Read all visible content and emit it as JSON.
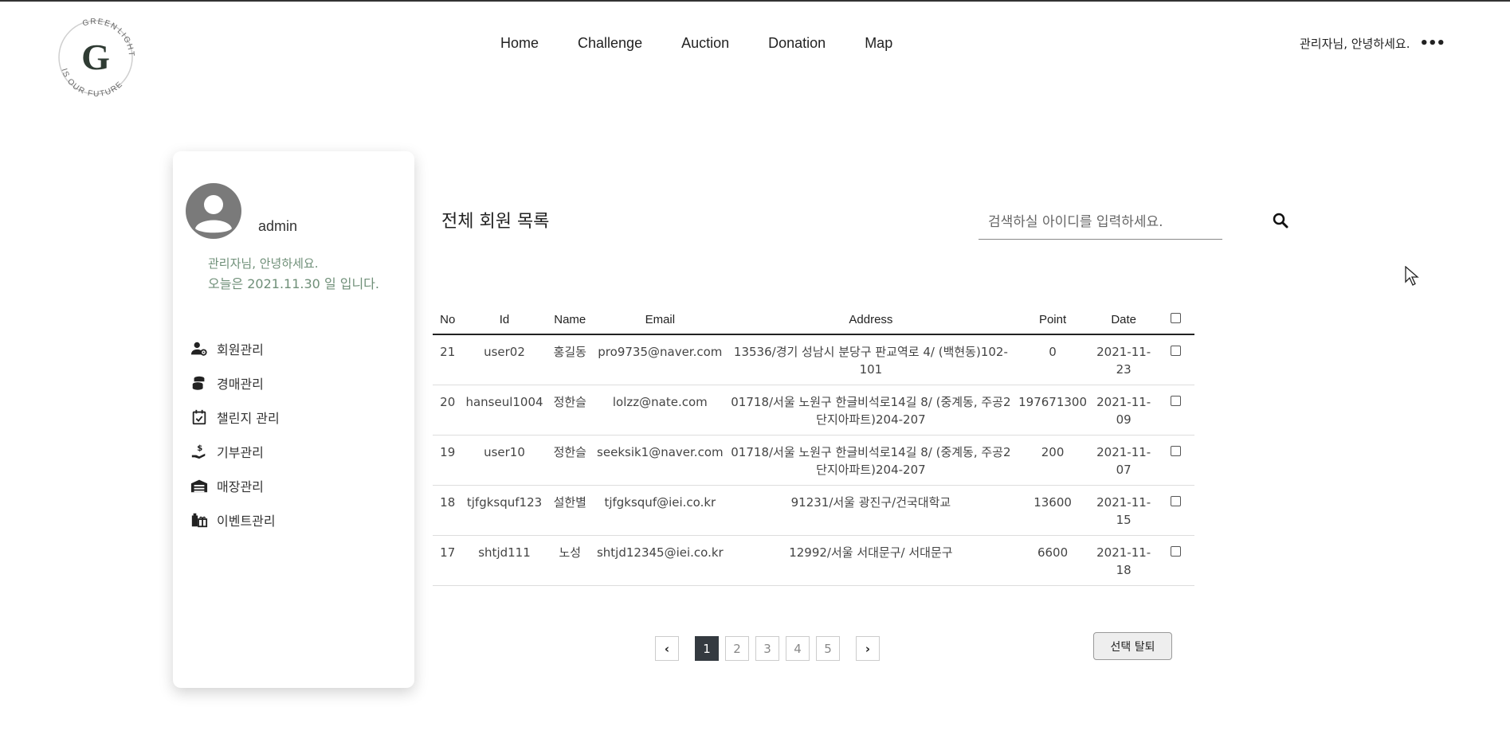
{
  "header": {
    "logo_text": [
      "GREEN",
      "LIGHT",
      "IS OUR FUTURE",
      "G"
    ],
    "nav": [
      "Home",
      "Challenge",
      "Auction",
      "Donation",
      "Map"
    ],
    "greeting": "관리자님, 안녕하세요.",
    "more_icon": "ellipsis-icon"
  },
  "sidebar": {
    "username": "admin",
    "welcome_line1": "관리자님, 안녕하세요.",
    "welcome_line2": "오늘은 2021.11.30 일 입니다.",
    "menu": [
      {
        "label": "회원관리",
        "icon": "user-gear-icon"
      },
      {
        "label": "경매관리",
        "icon": "coins-icon"
      },
      {
        "label": "챌린지 관리",
        "icon": "calendar-check-icon"
      },
      {
        "label": "기부관리",
        "icon": "hand-dollar-icon"
      },
      {
        "label": "매장관리",
        "icon": "warehouse-icon"
      },
      {
        "label": "이벤트관리",
        "icon": "gift-building-icon"
      }
    ]
  },
  "main": {
    "title": "전체 회원 목록",
    "search_placeholder": "검색하실 아이디를 입력하세요.",
    "columns": [
      "No",
      "Id",
      "Name",
      "Email",
      "Address",
      "Point",
      "Date"
    ],
    "rows": [
      {
        "no": "21",
        "id": "user02",
        "name": "홍길동",
        "email": "pro9735@naver.com",
        "address": "13536/경기 성남시 분당구 판교역로 4/ (백현동)102-101",
        "point": "0",
        "date": "2021-11-23"
      },
      {
        "no": "20",
        "id": "hanseul1004",
        "name": "정한슬",
        "email": "lolzz@nate.com",
        "address": "01718/서울 노원구 한글비석로14길 8/ (중계동, 주공2단지아파트)204-207",
        "point": "197671300",
        "date": "2021-11-09"
      },
      {
        "no": "19",
        "id": "user10",
        "name": "정한슬",
        "email": "seeksik1@naver.com",
        "address": "01718/서울 노원구 한글비석로14길 8/ (중계동, 주공2단지아파트)204-207",
        "point": "200",
        "date": "2021-11-07"
      },
      {
        "no": "18",
        "id": "tjfgksquf123",
        "name": "설한별",
        "email": "tjfgksquf@iei.co.kr",
        "address": "91231/서울 광진구/건국대학교",
        "point": "13600",
        "date": "2021-11-15"
      },
      {
        "no": "17",
        "id": "shtjd111",
        "name": "노성",
        "email": "shtjd12345@iei.co.kr",
        "address": "12992/서울 서대문구/ 서대문구",
        "point": "6600",
        "date": "2021-11-18"
      }
    ],
    "pagination": {
      "prev": "‹",
      "pages": [
        "1",
        "2",
        "3",
        "4",
        "5"
      ],
      "active": "1",
      "next": "›"
    },
    "withdraw_label": "선택 탈퇴"
  },
  "colors": {
    "accent_green": "#6f8f78",
    "logo_green": "#2f3b33",
    "active_page": "#343a40"
  }
}
